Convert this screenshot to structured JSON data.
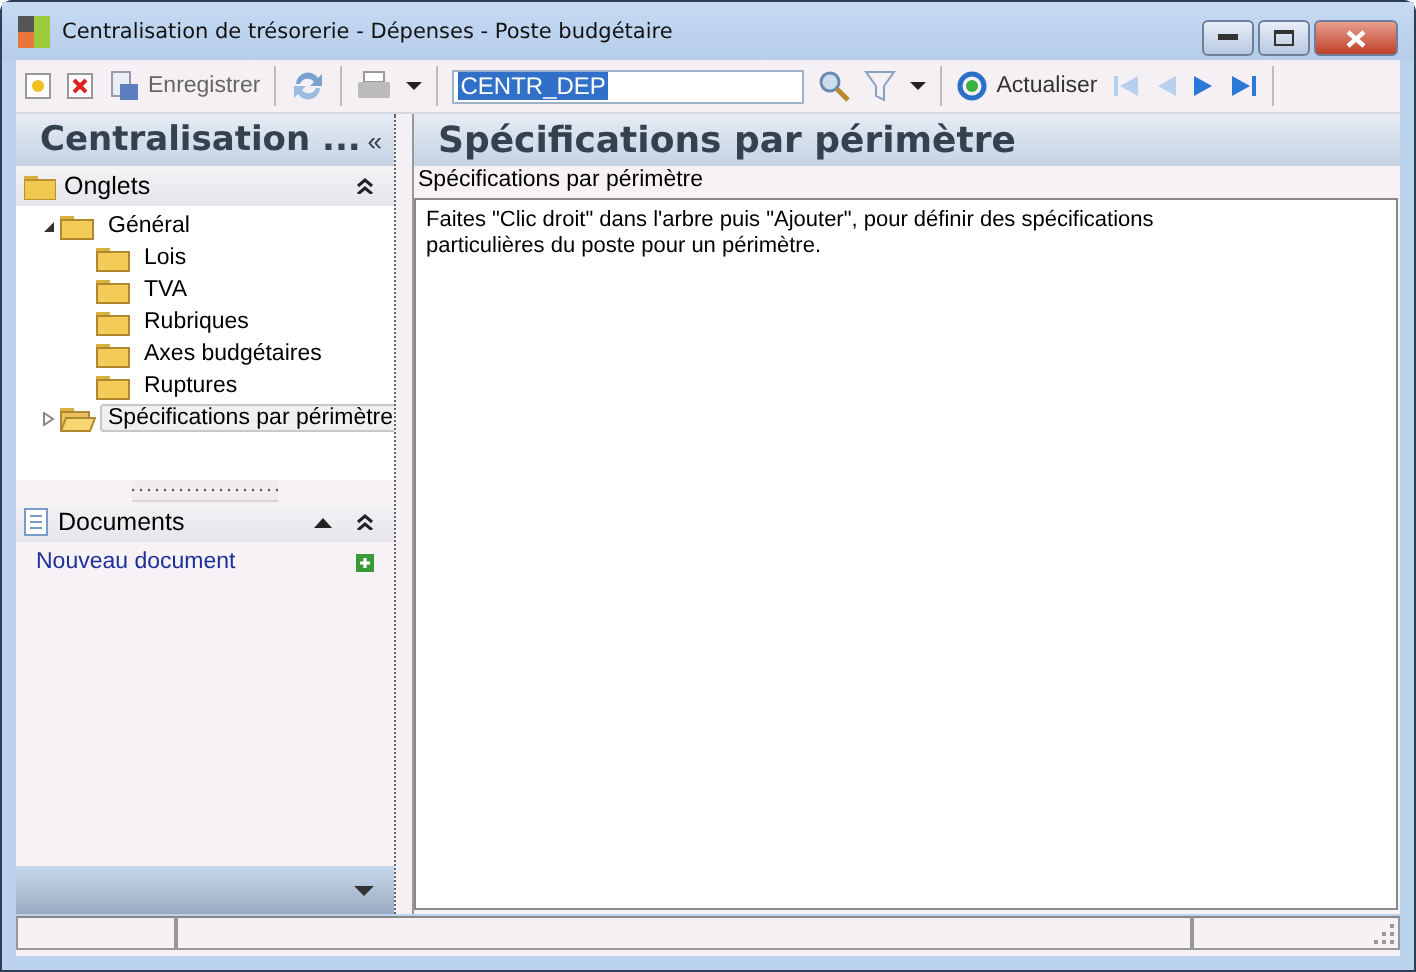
{
  "window": {
    "title": "Centralisation de trésorerie - Dépenses -  Poste budgétaire"
  },
  "toolbar": {
    "save_label": "Enregistrer",
    "search_value": "CENTR_DEP",
    "refresh_label": "Actualiser"
  },
  "left_panel": {
    "title": "Centralisation ...",
    "collapse": "«",
    "onglets": {
      "title": "Onglets",
      "tree": [
        {
          "label": "Général",
          "expanded": true,
          "selected": false,
          "children": [
            {
              "label": "Lois",
              "selected": false
            },
            {
              "label": "TVA",
              "selected": false
            },
            {
              "label": "Rubriques",
              "selected": false
            },
            {
              "label": "Axes budgétaires",
              "selected": false
            },
            {
              "label": "Ruptures",
              "selected": false
            }
          ]
        },
        {
          "label": "Spécifications par périmètre",
          "expanded": false,
          "selected": true
        }
      ]
    },
    "documents": {
      "title": "Documents",
      "items": [
        {
          "label": "Nouveau document"
        }
      ]
    }
  },
  "right_panel": {
    "title": "Spécifications par périmètre",
    "subtitle": "Spécifications par périmètre",
    "message": "Faites \"Clic droit\" dans l'arbre puis \"Ajouter\", pour définir des spécifications particulières du poste pour un périmètre."
  }
}
